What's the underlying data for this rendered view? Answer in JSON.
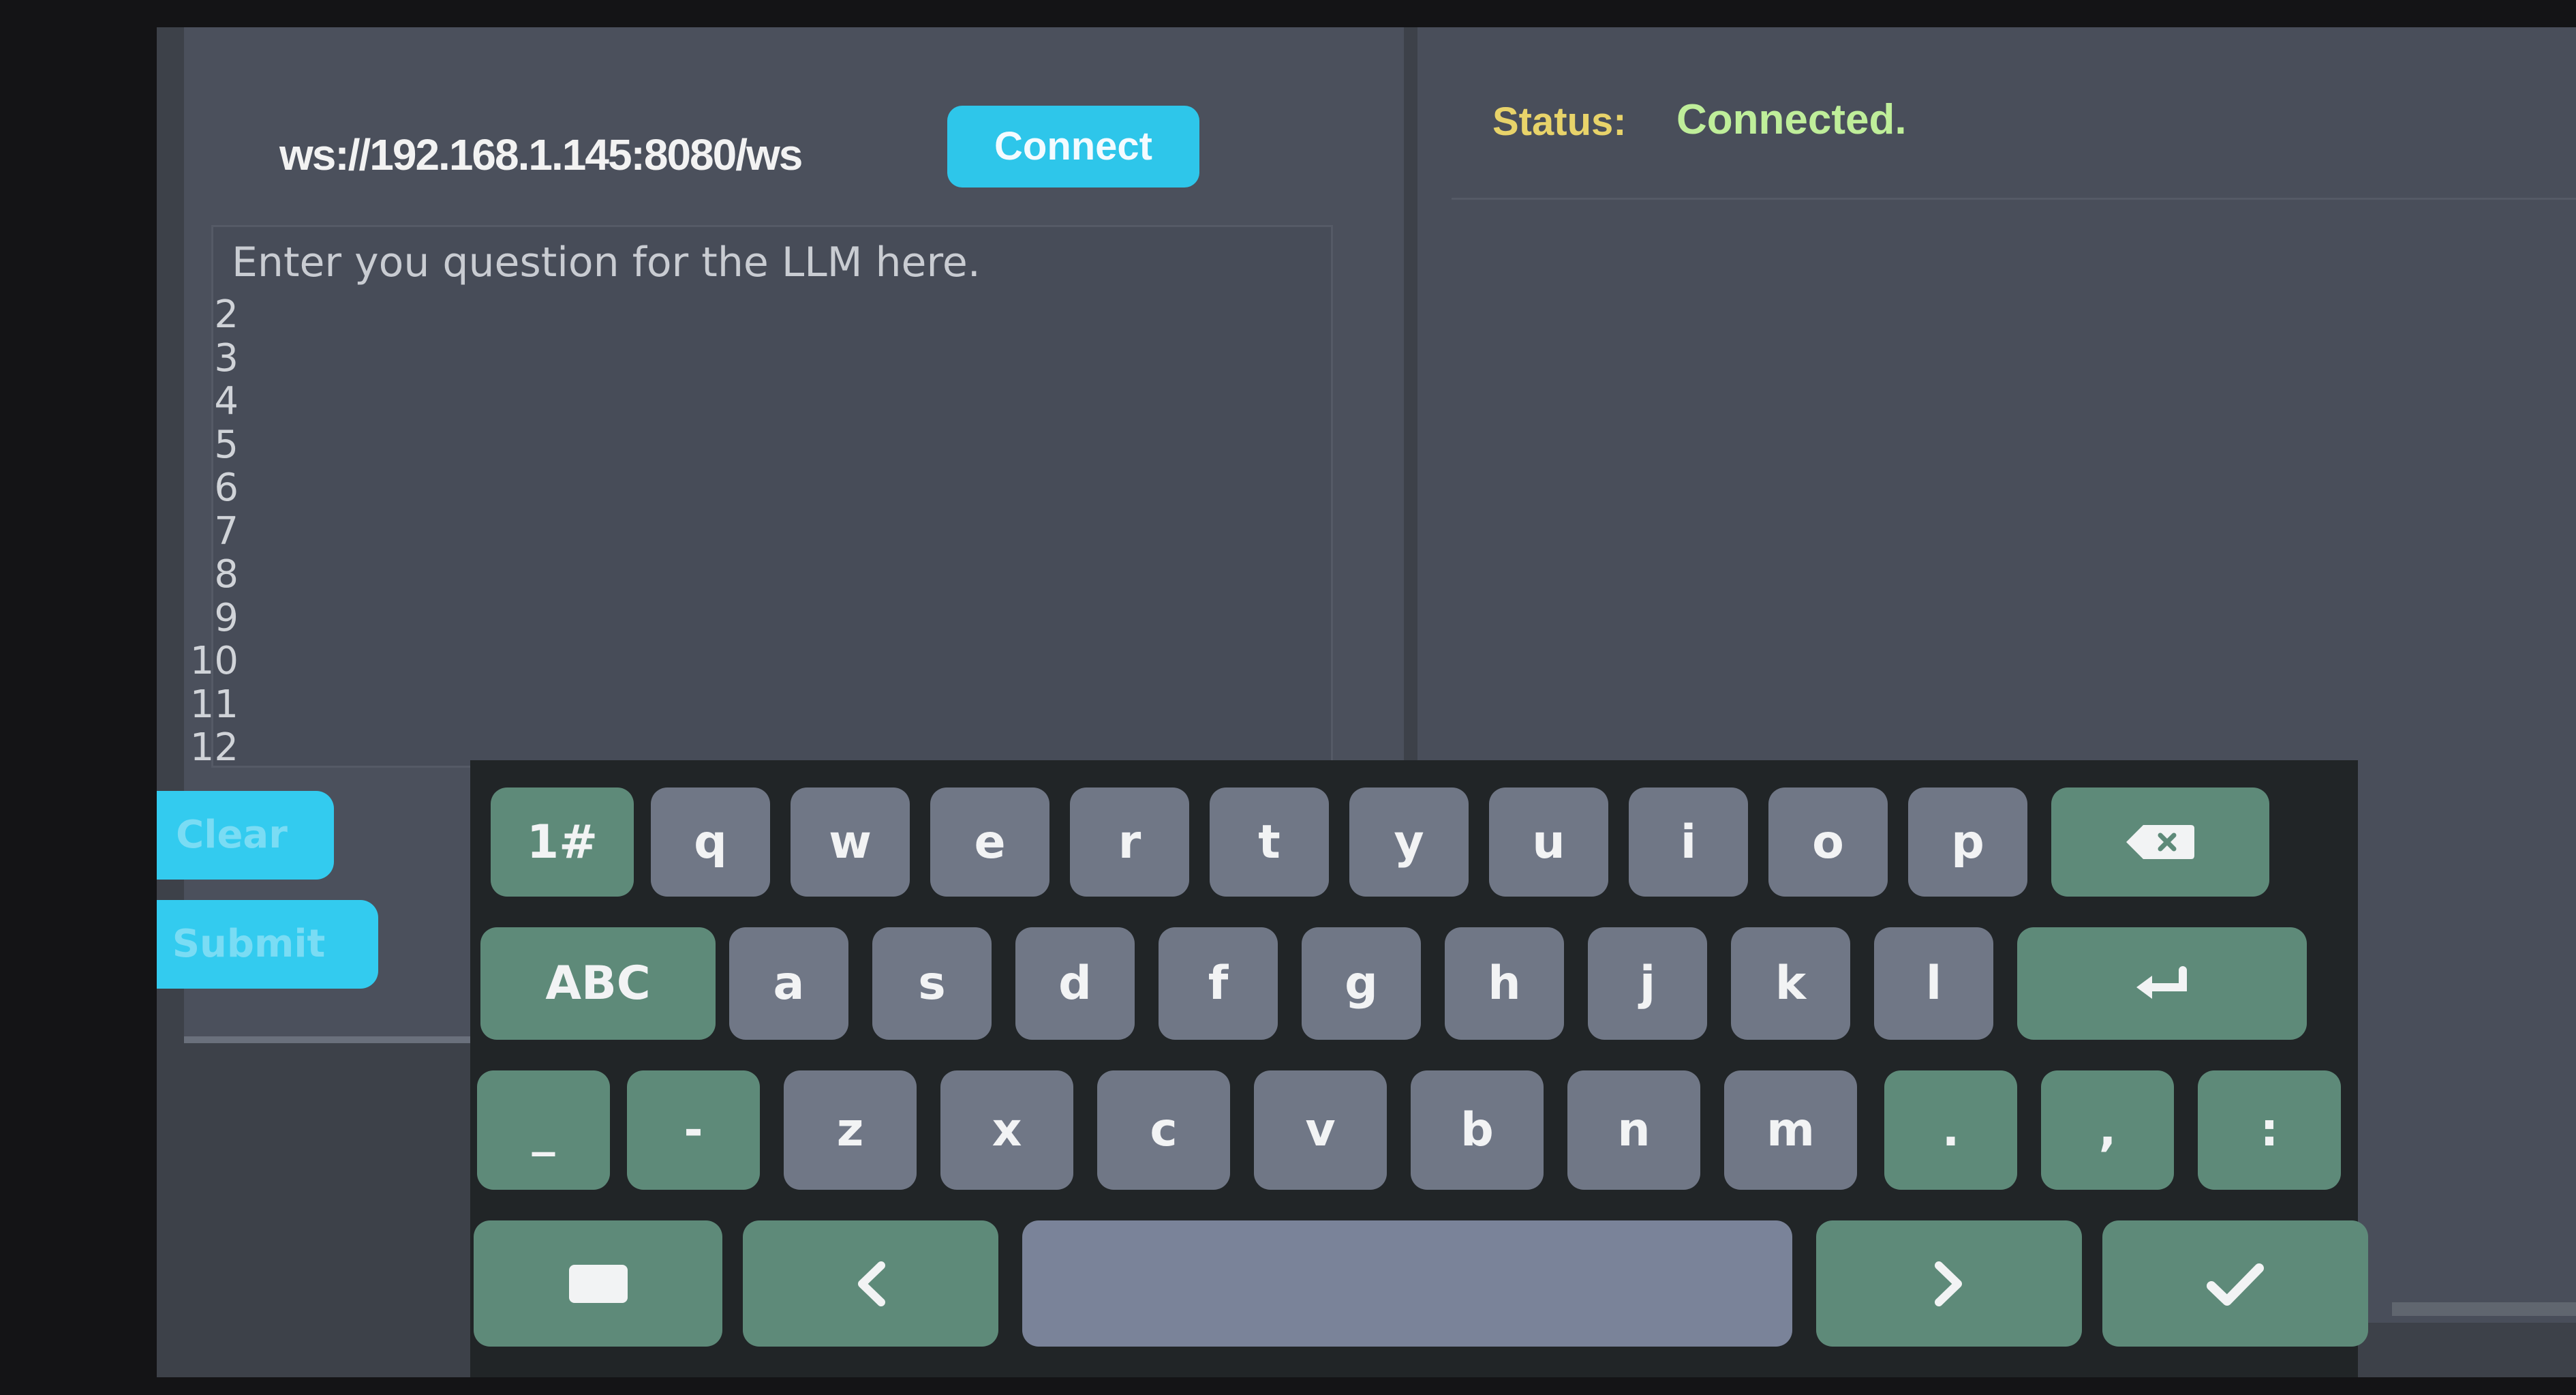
{
  "connection": {
    "url": "ws://192.168.1.145:8080/ws",
    "connect_label": "Connect"
  },
  "status": {
    "label": "Status:",
    "value": "Connected."
  },
  "editor": {
    "placeholder": "Enter you question for the LLM here.",
    "line_numbers": [
      "2",
      "3",
      "4",
      "5",
      "6",
      "7",
      "8",
      "9",
      "10",
      "11",
      "12"
    ]
  },
  "actions": {
    "clear_label": "Clear",
    "submit_label": "Submit"
  },
  "keyboard": {
    "row1": [
      "1#",
      "q",
      "w",
      "e",
      "r",
      "t",
      "y",
      "u",
      "i",
      "o",
      "p"
    ],
    "row2": [
      "ABC",
      "a",
      "s",
      "d",
      "f",
      "g",
      "h",
      "j",
      "k",
      "l"
    ],
    "row3": [
      "_",
      "-",
      "z",
      "x",
      "c",
      "v",
      "b",
      "n",
      "m",
      ".",
      ",",
      ":"
    ],
    "icons": [
      "backspace-icon",
      "enter-icon",
      "keyboard-hide-icon",
      "arrow-left-icon",
      "arrow-right-icon",
      "checkmark-icon"
    ]
  },
  "colors": {
    "accent": "#2ec6ea",
    "status_label": "#e8d36a",
    "status_value": "#bfee9a",
    "key_grey": "#707786",
    "key_green": "#5e8a79"
  }
}
